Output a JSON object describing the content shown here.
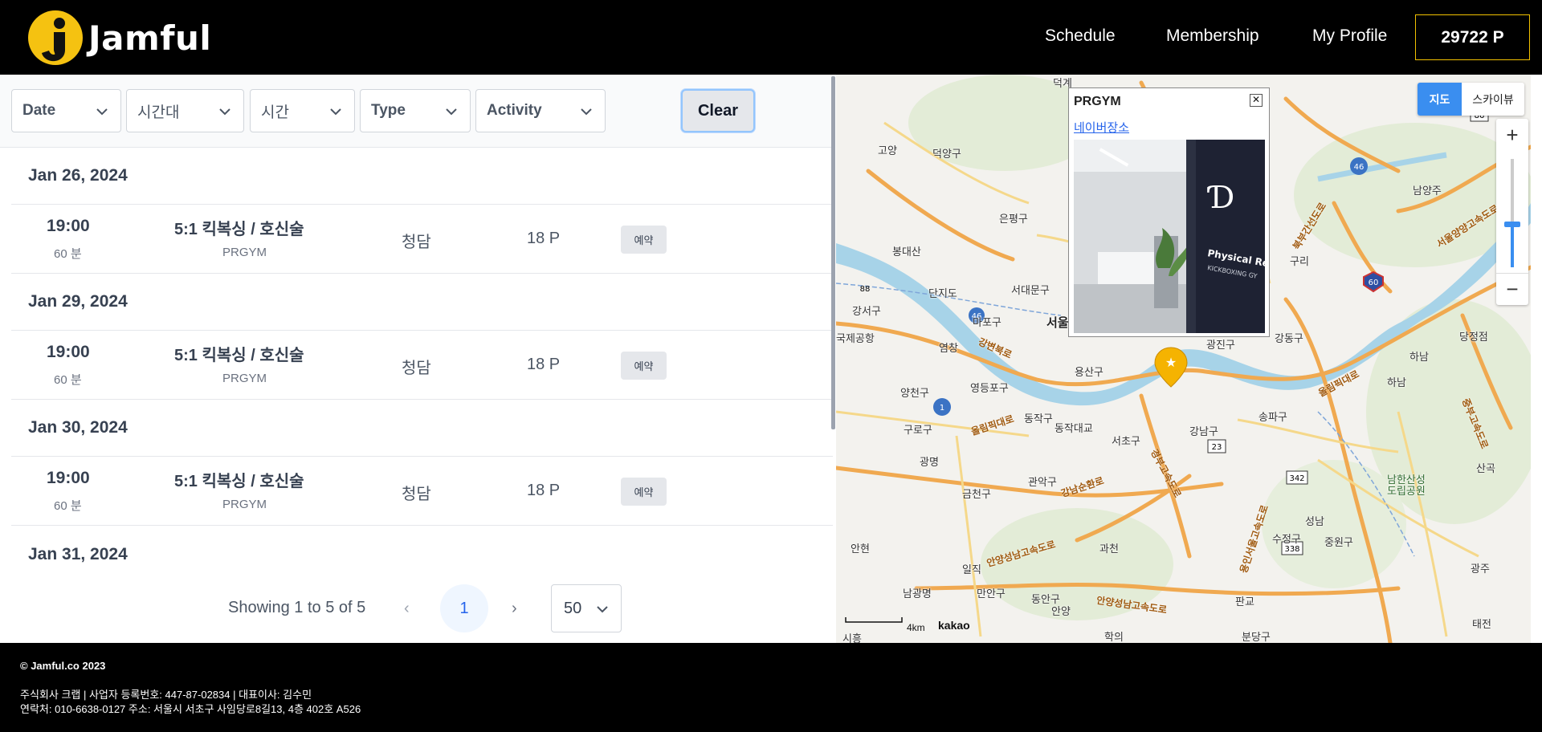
{
  "header": {
    "brand": "Jamful",
    "nav": {
      "schedule": "Schedule",
      "membership": "Membership",
      "profile": "My Profile"
    },
    "points": "29722 P"
  },
  "filters": {
    "date": "Date",
    "timeslot": "시간대",
    "time": "시간",
    "type": "Type",
    "activity": "Activity",
    "clear": "Clear"
  },
  "schedule": {
    "dates": [
      "Jan 26, 2024",
      "Jan 29, 2024",
      "Jan 30, 2024",
      "Jan 31, 2024"
    ],
    "classes": [
      {
        "time": "19:00",
        "duration": "60 분",
        "name": "5:1 킥복싱 / 호신술",
        "gym": "PRGYM",
        "location": "청담",
        "price": "18 P",
        "action": "예약"
      },
      {
        "time": "19:00",
        "duration": "60 분",
        "name": "5:1 킥복싱 / 호신술",
        "gym": "PRGYM",
        "location": "청담",
        "price": "18 P",
        "action": "예약"
      },
      {
        "time": "19:00",
        "duration": "60 분",
        "name": "5:1 킥복싱 / 호신술",
        "gym": "PRGYM",
        "location": "청담",
        "price": "18 P",
        "action": "예약"
      }
    ]
  },
  "pagination": {
    "showing": "Showing 1 to 5 of 5",
    "prev": "‹",
    "current": "1",
    "next": "›",
    "per_page": "50"
  },
  "map": {
    "type_map": "지도",
    "type_sky": "스카이뷰",
    "zoom_in": "+",
    "zoom_out": "−",
    "zoom_level": 0.4,
    "infowindow": {
      "title": "PRGYM",
      "link": "네이버장소",
      "close": "✕"
    },
    "photo_sign": "Physical Reme",
    "photo_sign2": "KICKBOXING GY",
    "scale": "4km",
    "provider": "kakao",
    "labels": {
      "goyang": "고양",
      "deogyang": "덕양구",
      "eunpyeong": "은평구",
      "bongdaesan": "봉대산",
      "gangseo": "강서구",
      "mapo": "마포구",
      "seodaemun": "서대문구",
      "seoul": "서울",
      "yeongdeungpo": "영등포구",
      "yangcheon": "양천구",
      "guro": "구로구",
      "dongjak": "동작구",
      "yongsan": "용산구",
      "seocho": "서초구",
      "gangnam": "강남구",
      "songpa": "송파구",
      "gwangjin": "광진구",
      "gangdong": "강동구",
      "guri": "구리",
      "namyangju": "남양주",
      "hanam": "하남",
      "gwangmyeong": "광명",
      "geumcheon": "금천구",
      "gwanak": "관악구",
      "gwacheon": "과천",
      "anyang": "안양",
      "dongan": "동안구",
      "manan": "만안구",
      "seongnam": "성남",
      "sujeong": "수정구",
      "jungwon": "중원구",
      "gwangju": "광주",
      "namhansanseong": "남한산성 도립공원",
      "hanam2": "하남",
      "dangjeong": "당정점",
      "sanseong": "산곡",
      "ilsan": "일직",
      "anhyeon": "안현",
      "namgwangmyeong": "남광명",
      "dongjakdaegyo": "동작대교",
      "gimpo": "국제공항",
      "yeongdeungpo_st": "염창",
      "siheung": "시흥",
      "bundang": "분당구",
      "pangyo": "판교",
      "uiwang": "학의",
      "taejeon": "태전",
      "daegwang": "단지도",
      "deokgye": "덕계"
    },
    "roads": {
      "olympic1": "올림픽대로",
      "olympic2": "올림픽대로",
      "gangbyeon": "강변북로",
      "seoul_ring": "서울양양고속도로",
      "gangnam_sunhwan": "강남순환로",
      "gyeongbu": "경부고속도로",
      "yongin_seoul": "용인서울고속도로",
      "anyang_seongnam": "안양성남고속도로",
      "bukbu": "북부간선도로",
      "jungbu": "중부고속도로"
    },
    "shields": [
      "371",
      "86",
      "46",
      "60",
      "88",
      "46",
      "1",
      "23",
      "342",
      "338"
    ]
  },
  "footer": {
    "copyright": "© Jamful.co 2023",
    "line1": "주식회사 크랩 | 사업자 등록번호: 447-87-02834 | 대표이사: 김수민",
    "line2": "연락처: 010-6638-0127 주소: 서울시 서초구 사임당로8길13, 4층 402호 A526"
  }
}
